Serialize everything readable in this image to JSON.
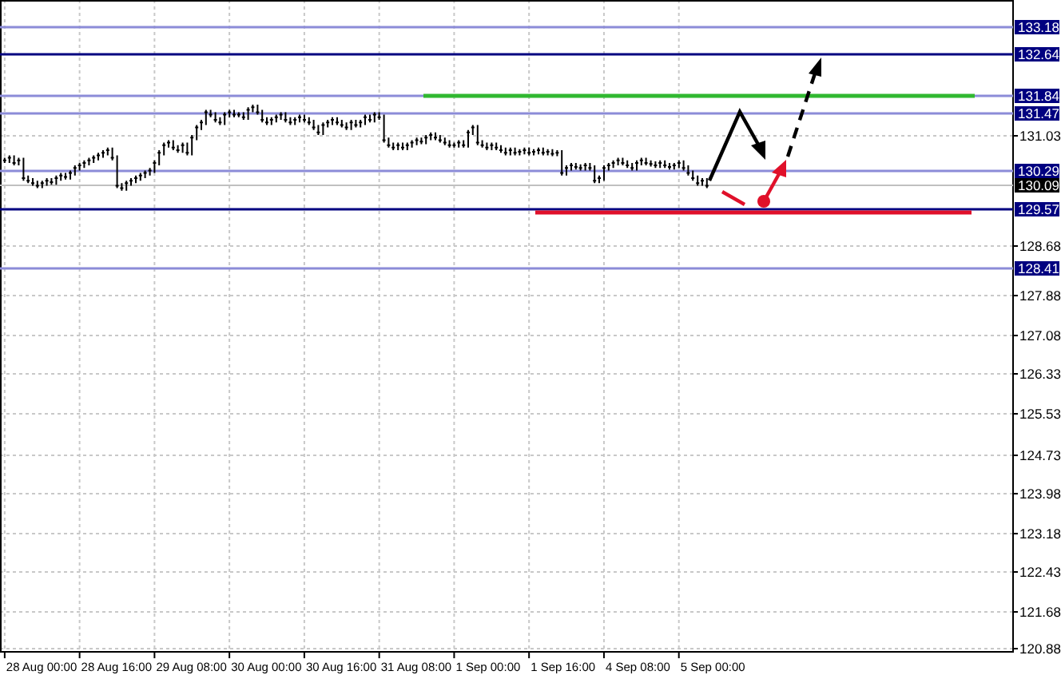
{
  "price_axis": {
    "labels": [
      "131.03",
      "128.68",
      "127.88",
      "127.08",
      "126.33",
      "125.53",
      "124.73",
      "123.98",
      "123.18",
      "122.43",
      "121.68",
      "120.88"
    ]
  },
  "levels": [
    {
      "label": "133.18",
      "kind": "minor"
    },
    {
      "label": "132.64",
      "kind": "major"
    },
    {
      "label": "131.84",
      "kind": "minor"
    },
    {
      "label": "131.47",
      "kind": "minor"
    },
    {
      "label": "130.29",
      "kind": "minor"
    },
    {
      "label": "130.09",
      "kind": "current"
    },
    {
      "label": "129.57",
      "kind": "major"
    },
    {
      "label": "128.41",
      "kind": "minor"
    }
  ],
  "time_axis": {
    "labels": [
      "28 Aug 00:00",
      "28 Aug 16:00",
      "29 Aug 08:00",
      "30 Aug 00:00",
      "30 Aug 16:00",
      "31 Aug 08:00",
      "1 Sep 00:00",
      "1 Sep 16:00",
      "4 Sep 08:00",
      "5 Sep 00:00"
    ]
  }
}
